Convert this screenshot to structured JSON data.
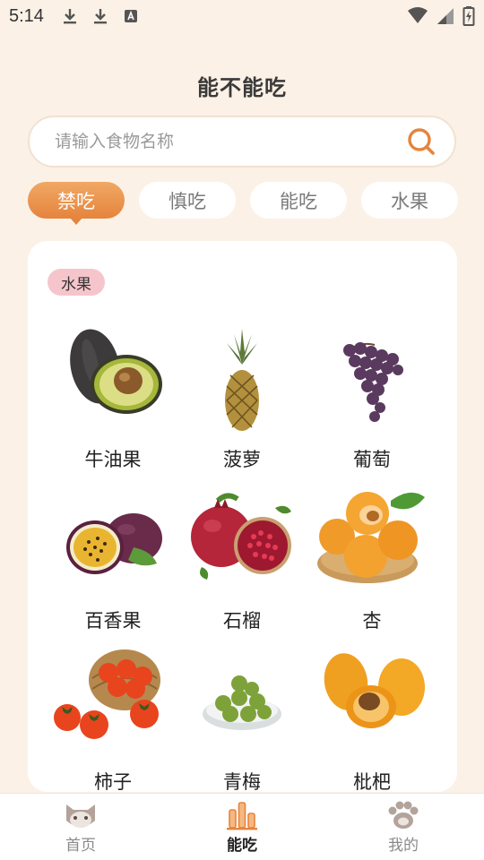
{
  "status_bar": {
    "time": "5:14",
    "icons": [
      "download-icon",
      "download-icon",
      "text-a-icon",
      "wifi-icon",
      "signal-icon",
      "battery-charging-icon"
    ]
  },
  "app_title": "能不能吃",
  "search": {
    "placeholder": "请输入食物名称",
    "value": "",
    "icon": "search-icon"
  },
  "tabs": [
    {
      "label": "禁吃",
      "active": true
    },
    {
      "label": "慎吃",
      "active": false
    },
    {
      "label": "能吃",
      "active": false
    },
    {
      "label": "水果",
      "active": false
    }
  ],
  "section": {
    "badge": "水果",
    "items": [
      {
        "name": "牛油果",
        "icon": "avocado-icon"
      },
      {
        "name": "菠萝",
        "icon": "pineapple-icon"
      },
      {
        "name": "葡萄",
        "icon": "grapes-icon"
      },
      {
        "name": "百香果",
        "icon": "passion-fruit-icon"
      },
      {
        "name": "石榴",
        "icon": "pomegranate-icon"
      },
      {
        "name": "杏",
        "icon": "apricot-icon"
      },
      {
        "name": "柿子",
        "icon": "persimmon-icon"
      },
      {
        "name": "青梅",
        "icon": "green-plum-icon"
      },
      {
        "name": "枇杷",
        "icon": "loquat-icon"
      }
    ]
  },
  "bottom_nav": [
    {
      "label": "首页",
      "icon": "cat-face-icon",
      "active": false
    },
    {
      "label": "能吃",
      "icon": "bar-chart-icon",
      "active": true
    },
    {
      "label": "我的",
      "icon": "paw-icon",
      "active": false
    }
  ],
  "colors": {
    "background": "#fcf1e6",
    "accent": "#e5843d",
    "badge": "#f6c5cc"
  }
}
